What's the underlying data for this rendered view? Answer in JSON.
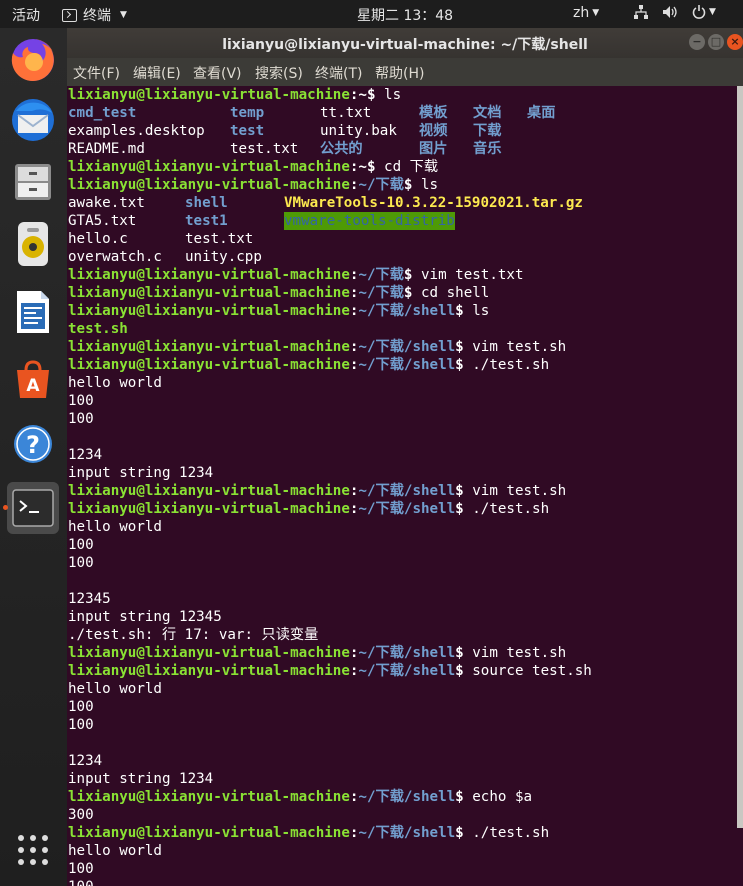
{
  "topbar": {
    "activities": "活动",
    "app_name": "终端",
    "clock": "星期二 13：48",
    "lang": "zh"
  },
  "window": {
    "title": "lixianyu@lixianyu-virtual-machine: ~/下载/shell",
    "menu": [
      "文件(F)",
      "编辑(E)",
      "查看(V)",
      "搜索(S)",
      "终端(T)",
      "帮助(H)"
    ]
  },
  "prompt": {
    "user_host": "lixianyu@lixianyu-virtual-machine",
    "home_suffix": ":~$ ",
    "dl_dir": "下载",
    "shell_dir": "shell"
  },
  "commands": {
    "c1": "ls",
    "c2": "cd 下载",
    "c3": "ls",
    "c4": "vim test.txt",
    "c5": "cd shell",
    "c6": "ls",
    "c7": "vim test.sh",
    "c8": "./test.sh",
    "c9": "vim test.sh",
    "c10": "./test.sh",
    "c11": "vim test.sh",
    "c12": "source test.sh",
    "c13": "echo $a",
    "c14": "./test.sh"
  },
  "ls_home": [
    [
      "cmd_test",
      "temp",
      "tt.txt",
      "模板",
      "文档",
      "桌面"
    ],
    [
      "examples.desktop",
      "test",
      "unity.bak",
      "视频",
      "下载",
      ""
    ],
    [
      "README.md",
      "test.txt",
      "公共的",
      "图片",
      "音乐",
      ""
    ]
  ],
  "ls_download": [
    [
      "awake.txt",
      "shell",
      "VMwareTools-10.3.22-15902021.tar.gz"
    ],
    [
      "GTA5.txt",
      "test1",
      "vmware-tools-distrib"
    ],
    [
      "hello.c",
      "test.txt",
      ""
    ],
    [
      "overwatch.c",
      "unity.cpp",
      ""
    ]
  ],
  "ls_shell": "test.sh",
  "outputs": {
    "hello": "hello world",
    "n100": "100",
    "in1": "1234",
    "str1": "input string 1234",
    "in2": "12345",
    "str2": "input string 12345",
    "err": "./test.sh: 行 17: var: 只读变量",
    "in3": "1234",
    "str3": "input string 1234",
    "echo_out": "300",
    "cut100": "100"
  },
  "colors": {
    "terminal_bg": "#300a24",
    "prompt_green": "#8ae234",
    "dir_blue": "#729fcf",
    "accent": "#e95420"
  },
  "dock_icons": [
    "firefox-icon",
    "thunderbird-icon",
    "files-icon",
    "rhythmbox-icon",
    "writer-icon",
    "software-icon",
    "help-icon",
    "terminal-icon",
    "apps-grid-icon"
  ]
}
